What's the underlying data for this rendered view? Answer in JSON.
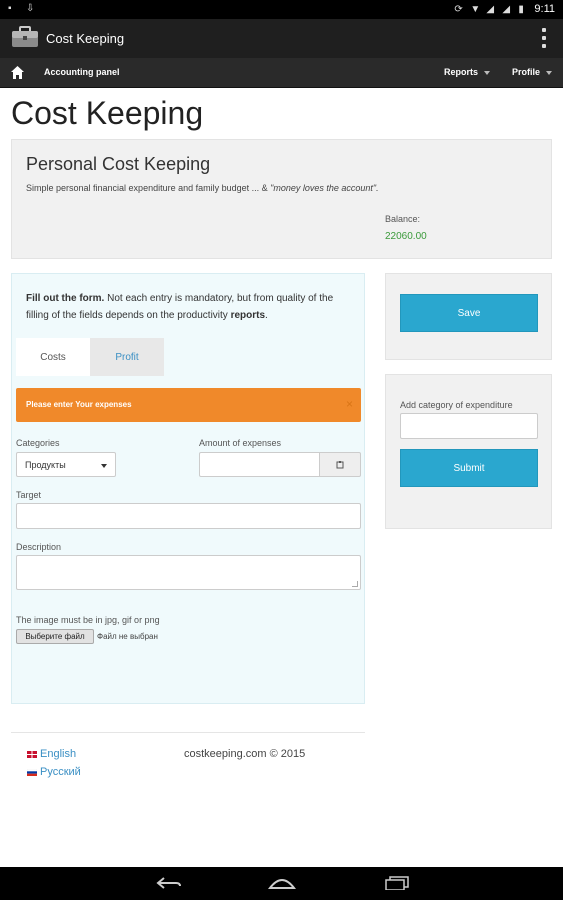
{
  "status_bar": {
    "time": "9:11"
  },
  "app_bar": {
    "title": "Cost Keeping"
  },
  "nav": {
    "panel": "Accounting panel",
    "reports": "Reports",
    "profile": "Profile"
  },
  "page": {
    "title": "Cost Keeping"
  },
  "jumbotron": {
    "title": "Personal Cost Keeping",
    "subtitle_plain": "Simple personal financial expenditure and family budget ... & ",
    "subtitle_quote": "\"money loves the account\".",
    "balance_label": "Balance:",
    "balance_value": "22060.00",
    "balance_color": "#3a9a3a"
  },
  "form": {
    "intro_bold": "Fill out the form.",
    "intro_text": " Not each entry is mandatory, but from quality of the filling of the fields depends on the productivity ",
    "intro_bold_end": "reports",
    "intro_end": ".",
    "tabs": [
      {
        "label": "Costs",
        "active": true
      },
      {
        "label": "Profit",
        "active": false
      }
    ],
    "alert": "Please enter Your expenses",
    "alert_color": "#f0892a",
    "categories_label": "Categories",
    "category_selected": "Продукты",
    "amount_label": "Amount of expenses",
    "amount_value": "",
    "target_label": "Target",
    "target_value": "",
    "description_label": "Description",
    "description_value": "",
    "image_hint": "The image must be in jpg, gif or png",
    "file_button": "Выберите файл",
    "file_status": "Файл не выбран"
  },
  "sidebar": {
    "save_button": "Save",
    "category_label": "Add category of expenditure",
    "category_value": "",
    "submit_button": "Submit",
    "accent_color": "#2aa7cf"
  },
  "footer": {
    "languages": [
      "English",
      "Русский"
    ],
    "copyright": "costkeeping.com © 2015"
  }
}
